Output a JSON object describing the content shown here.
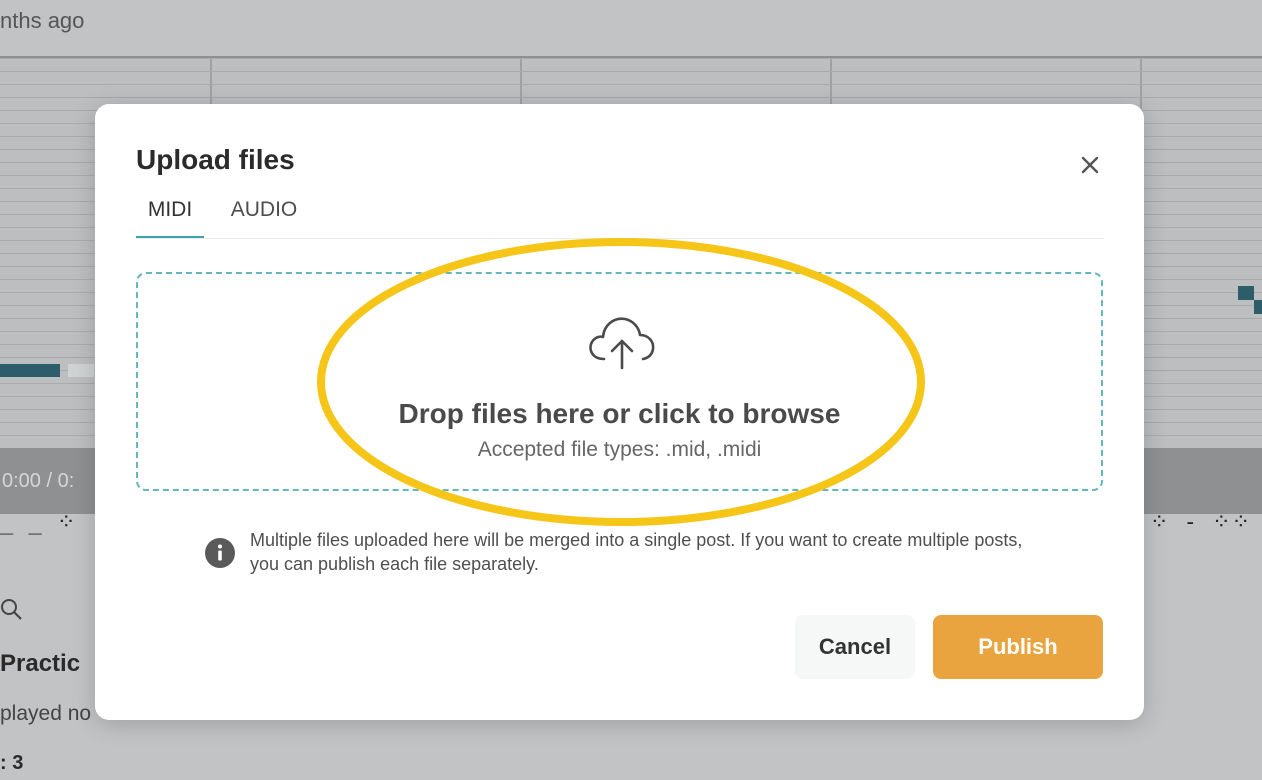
{
  "background": {
    "time_ago": "nths ago",
    "player_time": "0:00 / 0:",
    "notes_left": "_ _ ⁘",
    "notes_right": "⁘ - ⁘⁘",
    "section_title": "Practic",
    "played_text": "played no",
    "count_text": ": 3"
  },
  "modal": {
    "title": "Upload files",
    "tabs": [
      {
        "label": "MIDI",
        "active": true
      },
      {
        "label": "AUDIO",
        "active": false
      }
    ],
    "dropzone": {
      "primary_text": "Drop files here or click to browse",
      "secondary_text": "Accepted file types: .mid, .midi"
    },
    "info_text": "Multiple files uploaded here will be merged into a single post. If you want to create multiple posts, you can publish each file separately.",
    "buttons": {
      "cancel": "Cancel",
      "publish": "Publish"
    }
  },
  "colors": {
    "accent_teal": "#3fa0a8",
    "publish_orange": "#e9a33f",
    "highlight_yellow": "#f5c518"
  },
  "icons": {
    "close": "close-icon",
    "upload": "cloud-upload-icon",
    "info": "info-icon",
    "search": "search-icon"
  }
}
